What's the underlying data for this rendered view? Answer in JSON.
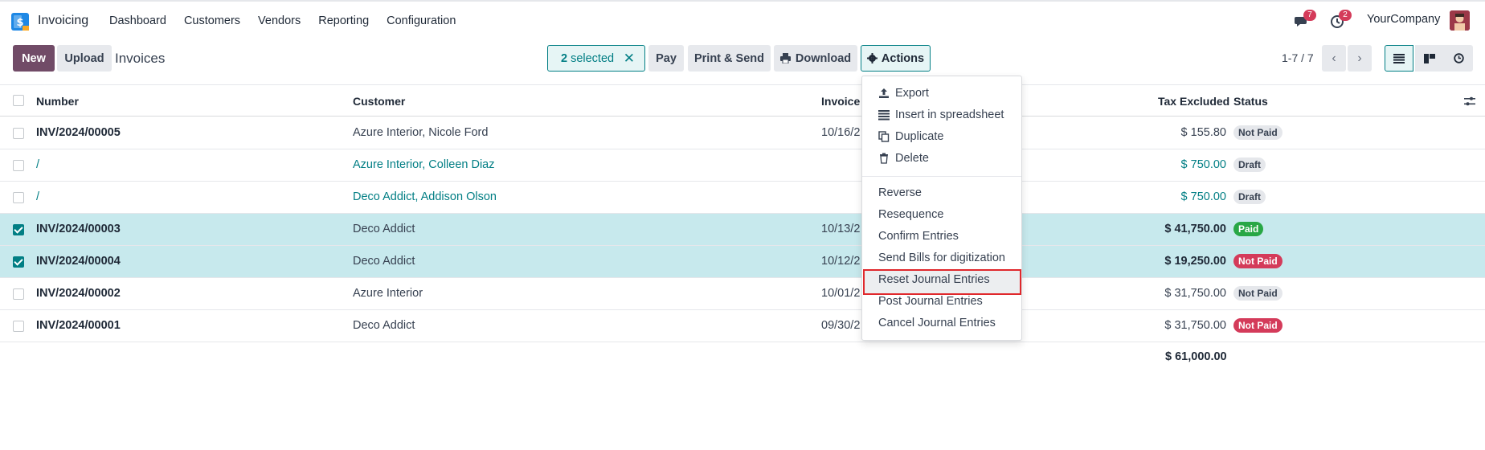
{
  "app": {
    "name": "Invoicing",
    "company": "YourCompany"
  },
  "menu": [
    "Dashboard",
    "Customers",
    "Vendors",
    "Reporting",
    "Configuration"
  ],
  "notifications": {
    "messages": "7",
    "activities": "2"
  },
  "toolbar": {
    "new_label": "New",
    "upload_label": "Upload",
    "breadcrumb": "Invoices",
    "selected_count": "2",
    "selected_label": "selected",
    "pay_label": "Pay",
    "print_send_label": "Print & Send",
    "download_label": "Download",
    "actions_label": "Actions",
    "pager": "1-7 / 7"
  },
  "table": {
    "columns": {
      "number": "Number",
      "customer": "Customer",
      "invoice_date": "Invoice",
      "tax_excluded": "Tax Excluded",
      "status": "Status"
    },
    "rows": [
      {
        "number": "INV/2024/00005",
        "customer": "Azure Interior, Nicole Ford",
        "date": "10/16/2",
        "amount": "$ 155.80",
        "status": "Not Paid",
        "selected": false
      },
      {
        "number": "/",
        "customer": "Azure Interior, Colleen Diaz",
        "date": "",
        "amount": "$ 750.00",
        "status": "Draft",
        "selected": false
      },
      {
        "number": "/",
        "customer": "Deco Addict, Addison Olson",
        "date": "",
        "amount": "$ 750.00",
        "status": "Draft",
        "selected": false
      },
      {
        "number": "INV/2024/00003",
        "customer": "Deco Addict",
        "date": "10/13/2",
        "amount": "$ 41,750.00",
        "status": "Paid",
        "selected": true
      },
      {
        "number": "INV/2024/00004",
        "customer": "Deco Addict",
        "date": "10/12/2",
        "amount": "$ 19,250.00",
        "status": "Not Paid",
        "selected": true
      },
      {
        "number": "INV/2024/00002",
        "customer": "Azure Interior",
        "date": "10/01/2",
        "amount": "$ 31,750.00",
        "status": "Not Paid",
        "selected": false
      },
      {
        "number": "INV/2024/00001",
        "customer": "Deco Addict",
        "date": "09/30/2",
        "amount": "$ 31,750.00",
        "status": "Not Paid",
        "selected": false
      }
    ],
    "total": "$ 61,000.00"
  },
  "actions_menu": {
    "group1": [
      "Export",
      "Insert in spreadsheet",
      "Duplicate",
      "Delete"
    ],
    "group2": [
      "Reverse",
      "Resequence",
      "Confirm Entries",
      "Send Bills for digitization",
      "Reset Journal Entries",
      "Post Journal Entries",
      "Cancel Journal Entries"
    ],
    "highlighted": "Reset Journal Entries"
  },
  "colors": {
    "brand": "#714b67",
    "accent": "#017e84",
    "danger": "#d43b5a",
    "success": "#28a745",
    "selected_row": "#c7e9ed",
    "highlight_border": "#e0282c"
  }
}
